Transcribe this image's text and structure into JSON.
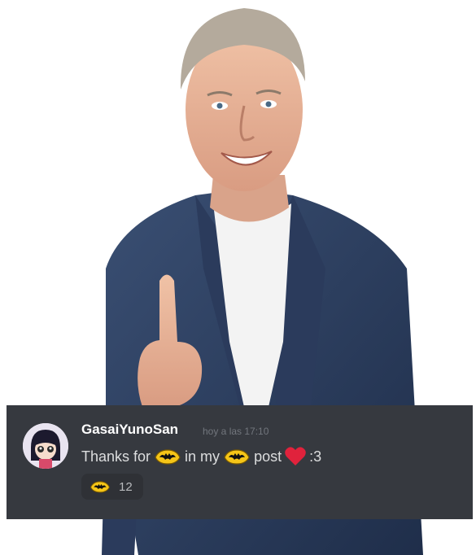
{
  "message": {
    "username": "GasaiYunoSan",
    "timestamp": "hoy a las 17:10",
    "content": {
      "text_1": "Thanks for",
      "text_2": "in my",
      "text_3": "post",
      "text_4": ":3",
      "emoji_1": "batman-emoji",
      "emoji_2": "batman-emoji",
      "emoji_3": "red-heart-emoji"
    },
    "reaction": {
      "emoji": "batman-emoji",
      "count": "12"
    }
  },
  "colors": {
    "card_background": "#36393f",
    "username": "#ffffff",
    "timestamp": "#72767d",
    "message_text": "#dcddde",
    "reaction_background": "#2f3136",
    "heart": "#e0223c",
    "emoji_yellow": "#f5c518"
  }
}
